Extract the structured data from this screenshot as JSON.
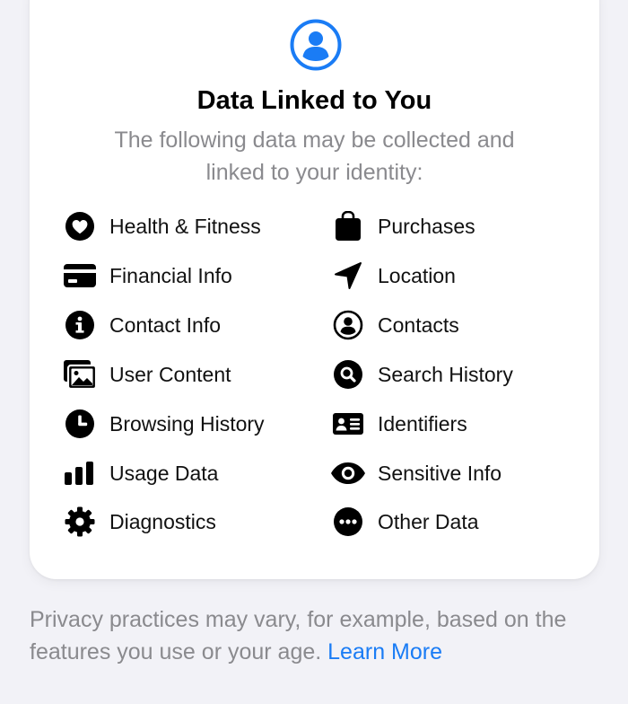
{
  "card": {
    "header_icon": "person-circle-icon",
    "title": "Data Linked to You",
    "subtitle": "The following data may be collected and linked to your identity:",
    "accent_color": "#1a7cf5"
  },
  "categories": [
    {
      "label": "Health & Fitness",
      "icon": "heart-icon"
    },
    {
      "label": "Purchases",
      "icon": "shopping-bag-icon"
    },
    {
      "label": "Financial Info",
      "icon": "credit-card-icon"
    },
    {
      "label": "Location",
      "icon": "location-arrow-icon"
    },
    {
      "label": "Contact Info",
      "icon": "info-circle-icon"
    },
    {
      "label": "Contacts",
      "icon": "person-circle-icon"
    },
    {
      "label": "User Content",
      "icon": "photos-icon"
    },
    {
      "label": "Search History",
      "icon": "magnifying-glass-circle-icon"
    },
    {
      "label": "Browsing History",
      "icon": "clock-icon"
    },
    {
      "label": "Identifiers",
      "icon": "id-card-icon"
    },
    {
      "label": "Usage Data",
      "icon": "bar-chart-icon"
    },
    {
      "label": "Sensitive Info",
      "icon": "eye-icon"
    },
    {
      "label": "Diagnostics",
      "icon": "gear-icon"
    },
    {
      "label": "Other Data",
      "icon": "ellipsis-circle-icon"
    }
  ],
  "footer": {
    "text": "Privacy practices may vary, for example, based on the features you use or your age.",
    "link_label": "Learn More"
  }
}
